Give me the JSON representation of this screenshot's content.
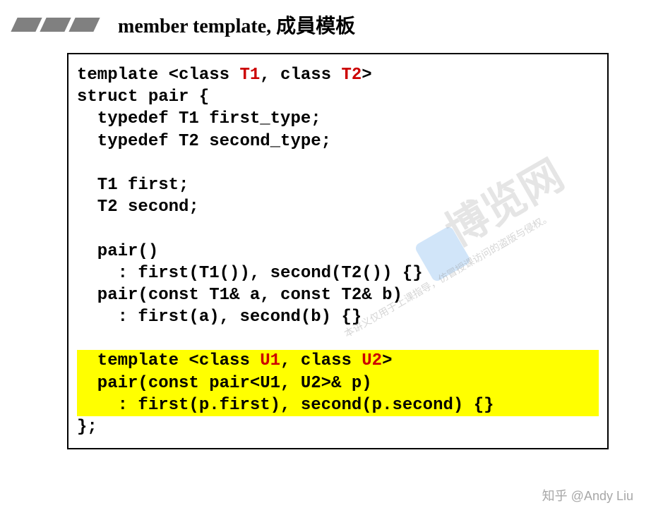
{
  "title": "member template, 成員模板",
  "code": {
    "l01_a": "template <class ",
    "l01_b": "T1",
    "l01_c": ", class ",
    "l01_d": "T2",
    "l01_e": ">",
    "l02": "struct pair {",
    "l03": "  typedef T1 first_type;",
    "l04": "  typedef T2 second_type;",
    "l05": "",
    "l06": "  T1 first;",
    "l07": "  T2 second;",
    "l08": "",
    "l09": "  pair()",
    "l10": "    : first(T1()), second(T2()) {}",
    "l11": "  pair(const T1& a, const T2& b)",
    "l12": "    : first(a), second(b) {}",
    "l13": "",
    "h1_a": "  template <class ",
    "h1_b": "U1",
    "h1_c": ", class ",
    "h1_d": "U2",
    "h1_e": ">",
    "h2": "  pair(const pair<U1, U2>& p)",
    "h3": "    : first(p.first), second(p.second) {}",
    "l17": "};"
  },
  "watermark_main": "博览网",
  "watermark_sub": "本讲义仅用于上课指导，仿冒授课访问的盗版与侵权。",
  "footer": "知乎 @Andy Liu"
}
